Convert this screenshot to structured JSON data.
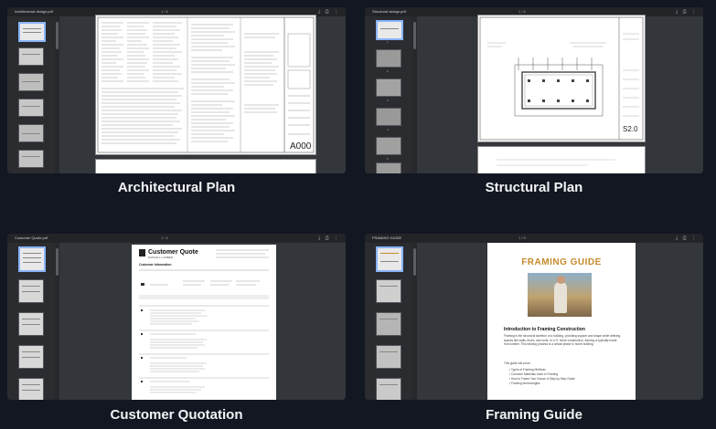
{
  "panels": [
    {
      "id": "architectural",
      "file_name": "Architectural design.pdf",
      "zoom": "1 / 6",
      "caption": "Architectural Plan",
      "sheet_tag": "A000",
      "thumb_pages": [
        "1",
        "2",
        "3",
        "4",
        "5",
        "6"
      ]
    },
    {
      "id": "structural",
      "file_name": "Structural design.pdf",
      "zoom": "1 / 6",
      "caption": "Structural Plan",
      "sheet_tag": "S2.0",
      "thumb_pages": [
        "1",
        "2",
        "3",
        "4",
        "5",
        "6"
      ]
    },
    {
      "id": "quotation",
      "file_name": "Customer Quote.pdf",
      "zoom": "1 / 4",
      "caption": "Customer Quotation",
      "quote_title": "Customer Quote",
      "quote_subtitle": "RANDALL LUMBER",
      "quote_info_heading": "Customer Information",
      "thumb_pages": [
        "1",
        "2",
        "3",
        "4",
        "5"
      ]
    },
    {
      "id": "framing",
      "file_name": "FRAMING GUIDE",
      "zoom": "1 / 5",
      "caption": "Framing Guide",
      "guide_title": "FRAMING GUIDE",
      "intro_heading": "Introduction to Framing Construction",
      "intro_text": "Framing is the structural skeleton of a building, providing support and shape while defining spaces like walls, floors, and roofs. In U.S. home construction, framing is typically made from lumber. This framing process is a critical phase in home building.",
      "list_lead": "This guide will cover:",
      "bullets": [
        "Types of Framing Methods",
        "Common Materials Used in Framing",
        "How to Frame Your House: A Step-by-Step Guide",
        "Framing terminologies"
      ],
      "thumb_pages": [
        "1",
        "2",
        "3",
        "4",
        "5"
      ]
    }
  ]
}
